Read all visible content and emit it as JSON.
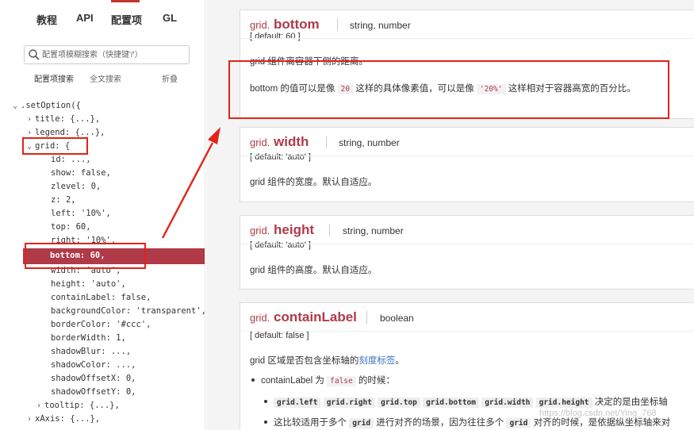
{
  "sidebar": {
    "tabs": [
      "教程",
      "API",
      "配置项",
      "GL"
    ],
    "active_tab": "配置项",
    "search_placeholder": "配置项模糊搜索（快捷键'/'）",
    "modes": {
      "config": "配置项搜索",
      "fulltext": "全文搜索",
      "collapse": "折叠"
    },
    "tree": {
      "root": ".setOption({",
      "title": "title: {...},",
      "legend": "legend: {...},",
      "grid": "grid: {",
      "children": [
        "id: ...,",
        "show: false,",
        "zlevel: 0,",
        "z: 2,",
        "left: '10%',",
        "top: 60,",
        "right: '10%',",
        "bottom: 60,",
        "width: 'auto',",
        "height: 'auto',",
        "containLabel: false,",
        "backgroundColor: 'transparent',",
        "borderColor: '#ccc',",
        "borderWidth: 1,",
        "shadowBlur: ...,",
        "shadowColor: ...,",
        "shadowOffsetX: 0,",
        "shadowOffsetY: 0,"
      ],
      "tooltip": "tooltip: {...},",
      "xaxis": "xAxis: {...},"
    }
  },
  "cards": {
    "bottom": {
      "prefix": "grid.",
      "name": "bottom",
      "type": "string, number",
      "default": "[ default: 60 ]",
      "desc1": "grid 组件离容器下侧的距离。",
      "desc2_a": "bottom 的值可以是像 ",
      "desc2_code1": "20",
      "desc2_b": " 这样的具体像素值，可以是像 ",
      "desc2_code2": "'20%'",
      "desc2_c": " 这样相对于容器高宽的百分比。"
    },
    "width": {
      "prefix": "grid.",
      "name": "width",
      "type": "string, number",
      "default": "[ default: 'auto' ]",
      "desc": "grid 组件的宽度。默认自适应。"
    },
    "height": {
      "prefix": "grid.",
      "name": "height",
      "type": "string, number",
      "default": "[ default: 'auto' ]",
      "desc": "grid 组件的高度。默认自适应。"
    },
    "containLabel": {
      "prefix": "grid.",
      "name": "containLabel",
      "type": "boolean",
      "default": "[ default: false ]",
      "desc_a": "grid 区域是否包含坐标轴的",
      "desc_link": "刻度标签",
      "desc_b": "。",
      "bullet1_a": "containLabel 为 ",
      "bullet1_code": "false",
      "bullet1_b": " 的时候：",
      "sub_codes": [
        "grid.left",
        "grid.right",
        "grid.top",
        "grid.bottom",
        "grid.width",
        "grid.height"
      ],
      "sub_tail": " 决定的是由坐标轴",
      "bullet2_a": "这比较适用于多个 ",
      "bullet2_code1": "grid",
      "bullet2_b": " 进行对齐的场景，因为往往多个 ",
      "bullet2_code2": "grid",
      "bullet2_c": " 对齐的时候，是依据纵坐标轴来对"
    }
  },
  "watermark": "https://blog.csdn.net/Ying_768",
  "colors": {
    "accent": "#b03a48",
    "annotation": "#e2231a",
    "link": "#3d73c5"
  }
}
